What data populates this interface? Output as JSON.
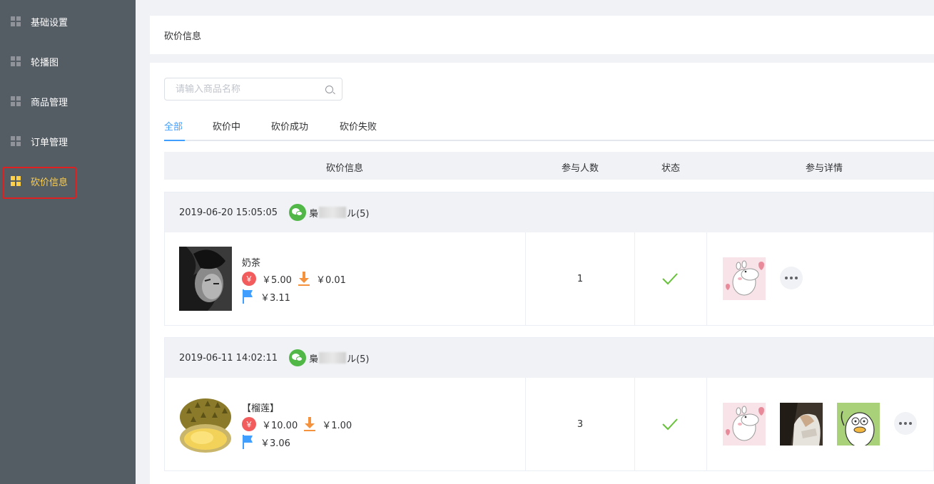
{
  "sidebar": {
    "items": [
      {
        "label": "基础设置",
        "icon": "grid-icon"
      },
      {
        "label": "轮播图",
        "icon": "grid-icon"
      },
      {
        "label": "商品管理",
        "icon": "grid-icon"
      },
      {
        "label": "订单管理",
        "icon": "grid-icon"
      },
      {
        "label": "砍价信息",
        "icon": "grid-icon",
        "active": true
      }
    ]
  },
  "header": {
    "title": "砍价信息"
  },
  "search": {
    "placeholder": "请输入商品名称",
    "value": ""
  },
  "tabs": [
    {
      "label": "全部",
      "active": true
    },
    {
      "label": "砍价中"
    },
    {
      "label": "砍价成功"
    },
    {
      "label": "砍价失败"
    }
  ],
  "table": {
    "columns": [
      "砍价信息",
      "参与人数",
      "状态",
      "参与详情"
    ]
  },
  "orders": [
    {
      "time": "2019-06-20 15:05:05",
      "user_prefix": "梟",
      "user_suffix": "ル(5)",
      "product": {
        "name": "奶茶",
        "original_price": "￥5.00",
        "floor_price": "￥0.01",
        "current_price": "￥3.11"
      },
      "participants": "1",
      "status": "success",
      "avatars": [
        "moomin-avatar"
      ]
    },
    {
      "time": "2019-06-11 14:02:11",
      "user_prefix": "梟",
      "user_suffix": "ル(5)",
      "product": {
        "name": "【榴莲】",
        "original_price": "￥10.00",
        "floor_price": "￥1.00",
        "current_price": "￥3.06"
      },
      "participants": "3",
      "status": "success",
      "avatars": [
        "moomin-avatar",
        "photo-avatar",
        "duck-avatar"
      ]
    }
  ],
  "icons": {
    "yen_symbol": "￥"
  },
  "colors": {
    "sidebar_bg": "#545c64",
    "active": "#ffd04b",
    "accent": "#409eff",
    "success": "#67c23a",
    "wechat": "#51b848"
  }
}
